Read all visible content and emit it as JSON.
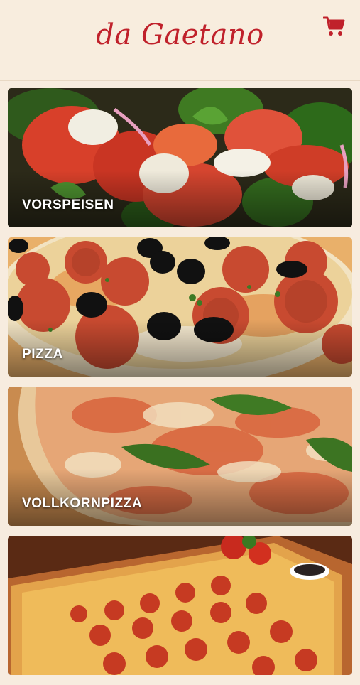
{
  "header": {
    "brand": "da Gaetano",
    "cart_icon": "shopping-cart-icon",
    "accent_color": "#c0212b"
  },
  "categories": [
    {
      "label": "VORSPEISEN"
    },
    {
      "label": "PIZZA"
    },
    {
      "label": "VOLLKORNPIZZA"
    },
    {
      "label": ""
    }
  ]
}
